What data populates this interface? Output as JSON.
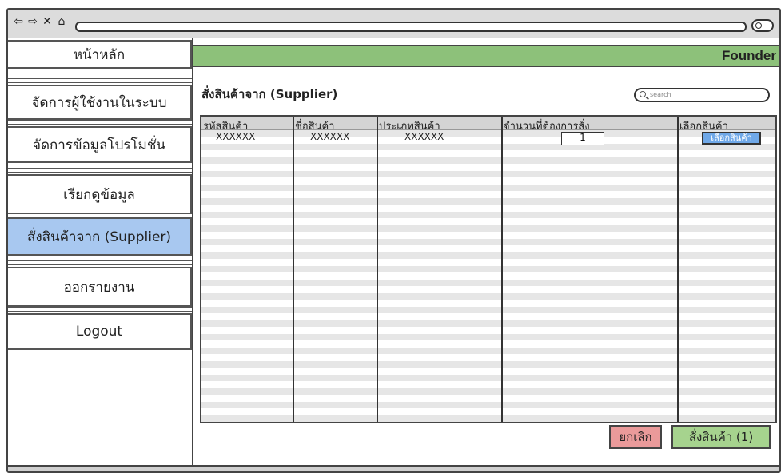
{
  "sidebar": {
    "items": [
      {
        "label": "หน้าหลัก"
      },
      {
        "label": "จัดการผู้ใช้งานในระบบ"
      },
      {
        "label": "จัดการข้อมูลโปรโมชั่น"
      },
      {
        "label": "เรียกดูข้อมูล"
      },
      {
        "label": "สั่งสินค้าจาก (Supplier)"
      },
      {
        "label": "ออกรายงาน"
      },
      {
        "label": "Logout"
      }
    ],
    "active_index": 4
  },
  "header": {
    "user": "Founder"
  },
  "main": {
    "title": "สั่งสินค้าจาก (Supplier)",
    "search": {
      "placeholder": "search"
    },
    "table": {
      "columns": [
        "รหัสสินค้า",
        "ชื่อสินค้า",
        "ประเภทสินค้า",
        "จำนวนที่ต้องการสั่ง",
        "เลือกสินค้า"
      ],
      "rows": [
        {
          "code": "XXXXXX",
          "name": "XXXXXX",
          "type": "XXXXXX",
          "quantity": "1",
          "select_label": "เลือกสินค้า"
        }
      ]
    },
    "buttons": {
      "cancel": "ยกเลิก",
      "order": "สั่งสินค้า (1)"
    }
  },
  "colors": {
    "header_bar": "#8dc17a",
    "active_sidebar": "#a8c8f0",
    "cancel_button": "#ea9a9a",
    "order_button": "#a6d38e",
    "select_button": "#6fa8e8"
  },
  "icons": [
    "back-arrow-icon",
    "forward-arrow-icon",
    "close-icon",
    "home-icon",
    "search-icon",
    "toggle-icon"
  ]
}
